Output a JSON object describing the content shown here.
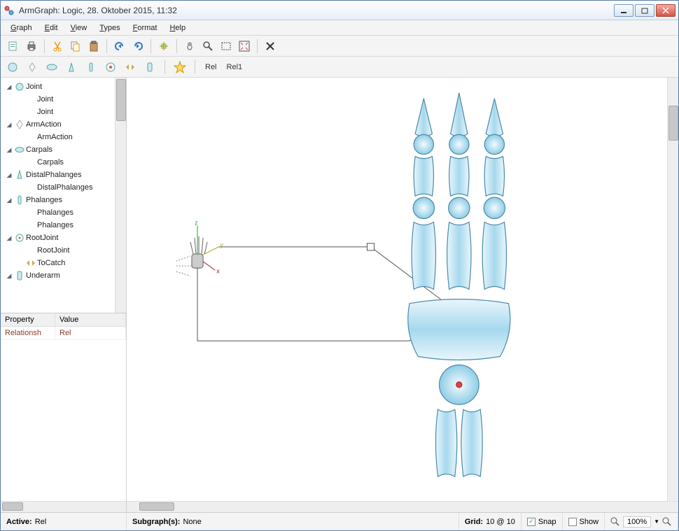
{
  "window": {
    "title": "ArmGraph: Logic, 28. Oktober 2015, 11:32"
  },
  "menu": {
    "graph": "Graph",
    "graph_u": "G",
    "edit": "Edit",
    "edit_u": "E",
    "view": "View",
    "view_u": "V",
    "types": "Types",
    "types_u": "T",
    "format": "Format",
    "format_u": "F",
    "help": "Help",
    "help_u": "H"
  },
  "toolbar": {
    "new": "new",
    "print": "print",
    "cut": "cut",
    "copy": "copy",
    "paste": "paste",
    "undo": "undo",
    "redo": "redo",
    "add": "add",
    "pan": "pan",
    "zoom": "zoom",
    "marquee": "marquee",
    "fit": "fit",
    "delete": "delete"
  },
  "palette": {
    "items": [
      "joint-circle",
      "arm-action",
      "carpals",
      "distal",
      "phalanges",
      "root-joint",
      "tocatch",
      "underarm"
    ],
    "rel": "Rel",
    "rel1": "Rel1"
  },
  "tree": {
    "items": [
      {
        "indent": 0,
        "expander": "◢",
        "icon": "joint",
        "label": "Joint"
      },
      {
        "indent": 1,
        "expander": "",
        "icon": "",
        "label": "Joint"
      },
      {
        "indent": 1,
        "expander": "",
        "icon": "",
        "label": "Joint"
      },
      {
        "indent": 0,
        "expander": "◢",
        "icon": "arm",
        "label": "ArmAction"
      },
      {
        "indent": 1,
        "expander": "",
        "icon": "",
        "label": "ArmAction"
      },
      {
        "indent": 0,
        "expander": "◢",
        "icon": "carpals",
        "label": "Carpals"
      },
      {
        "indent": 1,
        "expander": "",
        "icon": "",
        "label": "Carpals"
      },
      {
        "indent": 0,
        "expander": "◢",
        "icon": "distal",
        "label": "DistalPhalanges"
      },
      {
        "indent": 1,
        "expander": "",
        "icon": "",
        "label": "DistalPhalanges"
      },
      {
        "indent": 0,
        "expander": "◢",
        "icon": "phalanges",
        "label": "Phalanges"
      },
      {
        "indent": 1,
        "expander": "",
        "icon": "",
        "label": "Phalanges"
      },
      {
        "indent": 1,
        "expander": "",
        "icon": "",
        "label": "Phalanges"
      },
      {
        "indent": 0,
        "expander": "◢",
        "icon": "root",
        "label": "RootJoint"
      },
      {
        "indent": 1,
        "expander": "",
        "icon": "",
        "label": "RootJoint"
      },
      {
        "indent": 1,
        "expander": "",
        "icon": "tocatch",
        "label": "ToCatch"
      },
      {
        "indent": 0,
        "expander": "◢",
        "icon": "underarm",
        "label": "Underarm"
      }
    ]
  },
  "props": {
    "hdr_prop": "Property",
    "hdr_val": "Value",
    "rows": [
      {
        "prop": "Relationsh",
        "val": "Rel"
      }
    ]
  },
  "status": {
    "active_lbl": "Active:",
    "active_val": "Rel",
    "sub_lbl": "Subgraph(s):",
    "sub_val": "None",
    "grid_lbl": "Grid:",
    "grid_val": "10 @ 10",
    "snap": "Snap",
    "snap_on": true,
    "show": "Show",
    "show_on": false,
    "zoom": "100%"
  },
  "canvas": {
    "axes": {
      "x": "x",
      "y": "y",
      "z": "z"
    }
  },
  "colors": {
    "accent": "#4a7cbf",
    "bone_fill_light": "#e8f6fc",
    "bone_fill_dark": "#a7d8ed",
    "bone_stroke": "#4a8aa8"
  }
}
